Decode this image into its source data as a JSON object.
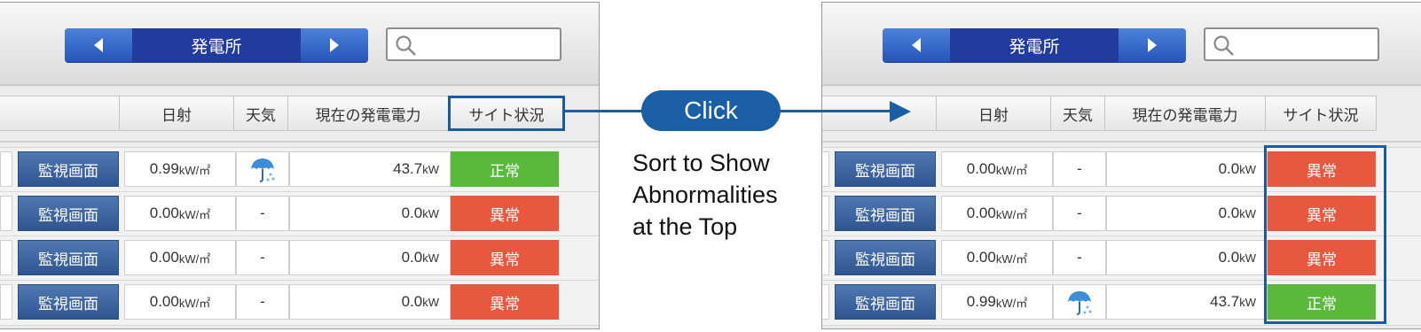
{
  "nav_title": "発電所",
  "headers": {
    "irradiance": "日射",
    "weather": "天気",
    "power": "現在の発電電力",
    "status": "サイト状況"
  },
  "callout": {
    "click_label": "Click",
    "caption_lines": [
      "Sort to Show",
      "Abnormalities",
      "at the Top"
    ]
  },
  "monitor_label": "監視画面",
  "units": {
    "irradiance": "kW/㎡",
    "power": "kW"
  },
  "colors": {
    "normal": "#5ab93b",
    "abnormal": "#e8583f",
    "accent": "#1a5fa5"
  },
  "before_rows": [
    {
      "irradiance": "0.99",
      "weather": "rain-umbrella-icon",
      "power": "43.7",
      "status": "正常"
    },
    {
      "irradiance": "0.00",
      "weather": "-",
      "power": "0.0",
      "status": "異常"
    },
    {
      "irradiance": "0.00",
      "weather": "-",
      "power": "0.0",
      "status": "異常"
    },
    {
      "irradiance": "0.00",
      "weather": "-",
      "power": "0.0",
      "status": "異常"
    }
  ],
  "after_rows": [
    {
      "irradiance": "0.00",
      "weather": "-",
      "power": "0.0",
      "status": "異常"
    },
    {
      "irradiance": "0.00",
      "weather": "-",
      "power": "0.0",
      "status": "異常"
    },
    {
      "irradiance": "0.00",
      "weather": "-",
      "power": "0.0",
      "status": "異常"
    },
    {
      "irradiance": "0.99",
      "weather": "rain-umbrella-icon",
      "power": "43.7",
      "status": "正常"
    }
  ]
}
